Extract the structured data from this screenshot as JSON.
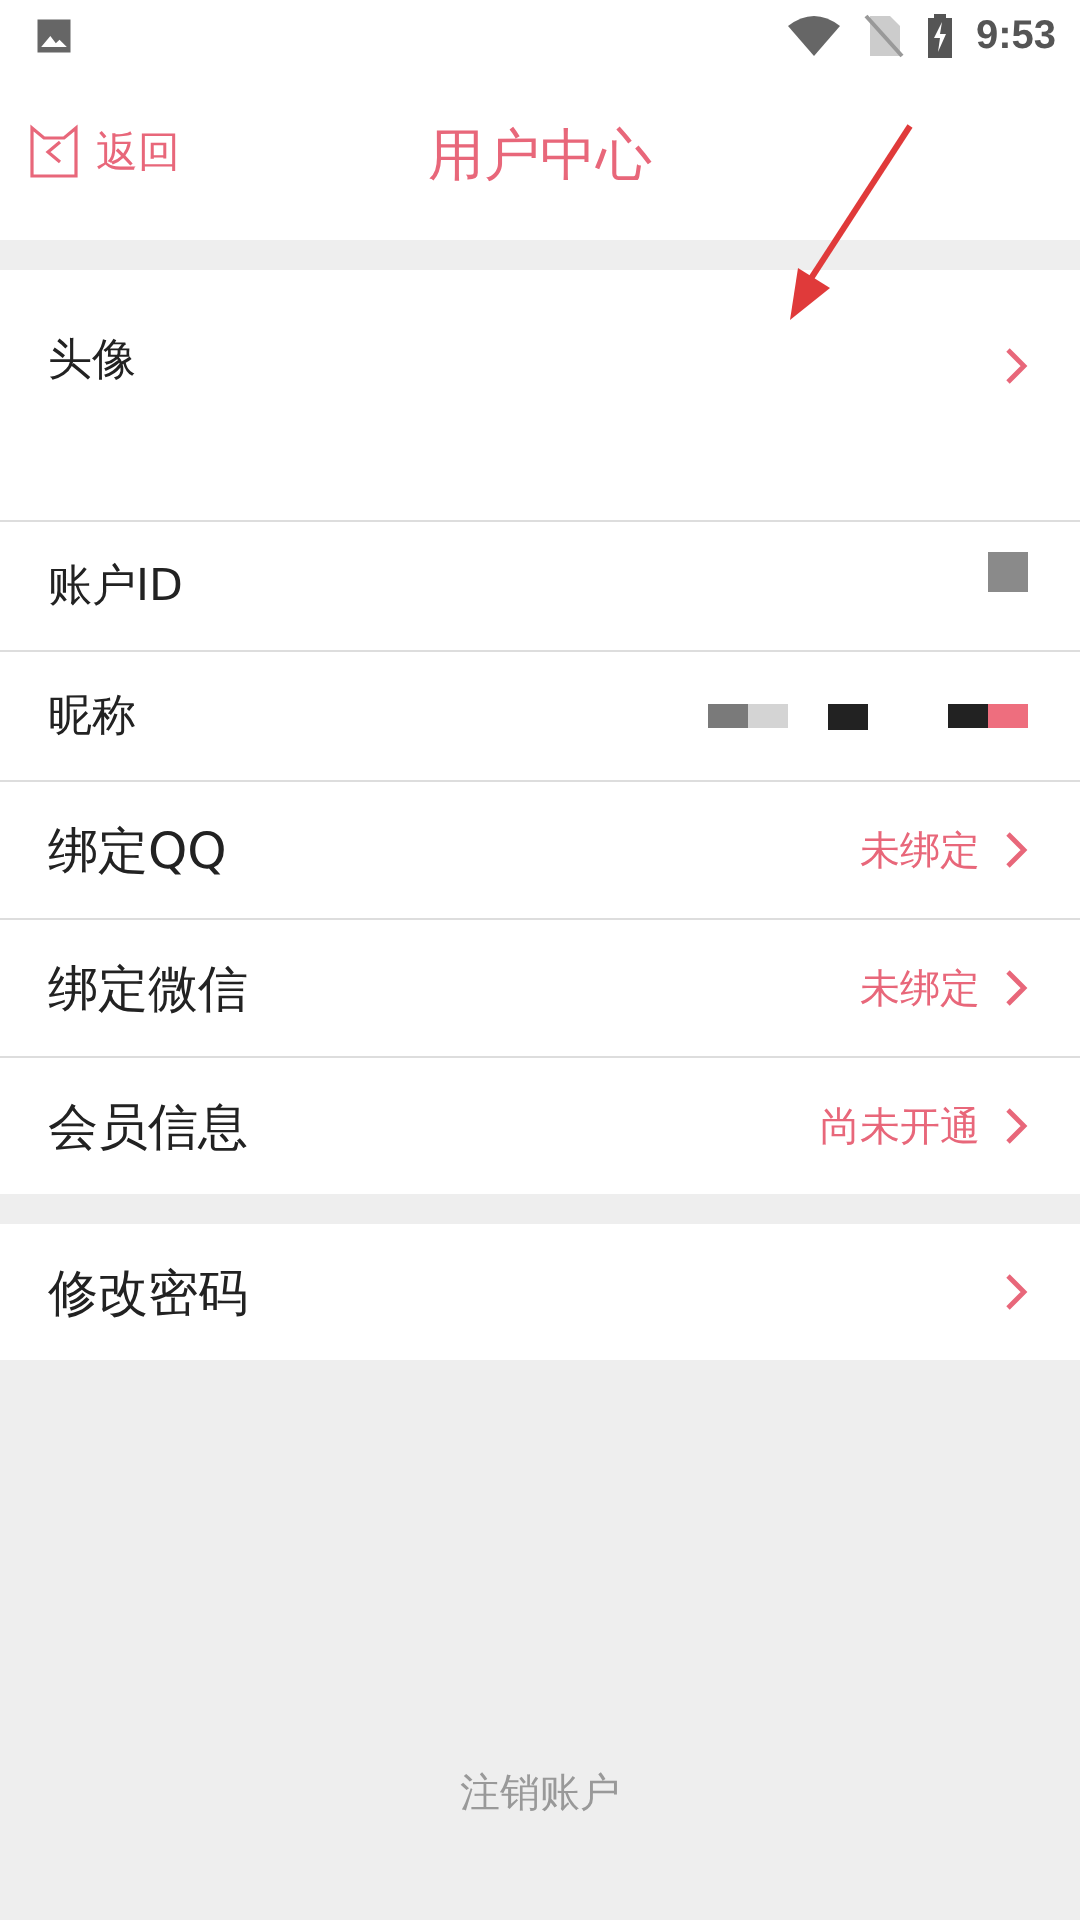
{
  "status_bar": {
    "time": "9:53"
  },
  "header": {
    "back_label": "返回",
    "title": "用户中心"
  },
  "sections": [
    {
      "rows": [
        {
          "label": "头像",
          "kind": "avatar",
          "large": false
        },
        {
          "label": "账户ID",
          "kind": "redacted_id",
          "large": false
        },
        {
          "label": "昵称",
          "kind": "redacted_name",
          "large": false
        },
        {
          "label": "绑定QQ",
          "kind": "status",
          "value": "未绑定",
          "large": true
        },
        {
          "label": "绑定微信",
          "kind": "status",
          "value": "未绑定",
          "large": true
        },
        {
          "label": "会员信息",
          "kind": "status",
          "value": "尚未开通",
          "large": true
        }
      ]
    },
    {
      "rows": [
        {
          "label": "修改密码",
          "kind": "link",
          "large": true
        }
      ]
    }
  ],
  "footer": {
    "logout_label": "注销账户"
  }
}
